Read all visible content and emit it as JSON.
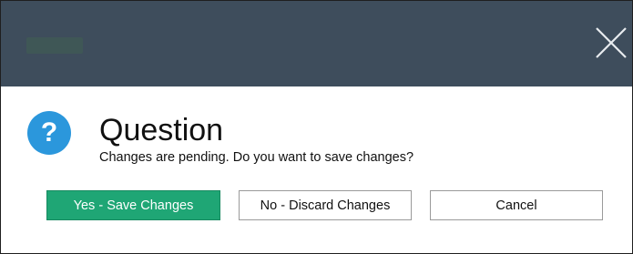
{
  "titlebar": {
    "logo_icon": "app-logo-icon",
    "close_icon": "close-icon"
  },
  "dialog": {
    "icon": "question-mark-icon",
    "icon_glyph": "?",
    "title": "Question",
    "message": "Changes are pending. Do you want to save changes?"
  },
  "buttons": {
    "yes_label": "Yes - Save Changes",
    "no_label": "No - Discard Changes",
    "cancel_label": "Cancel"
  },
  "colors": {
    "titlebar": "#3e4d5c",
    "icon_blue": "#2b97dc",
    "primary_green": "#1fa675"
  }
}
